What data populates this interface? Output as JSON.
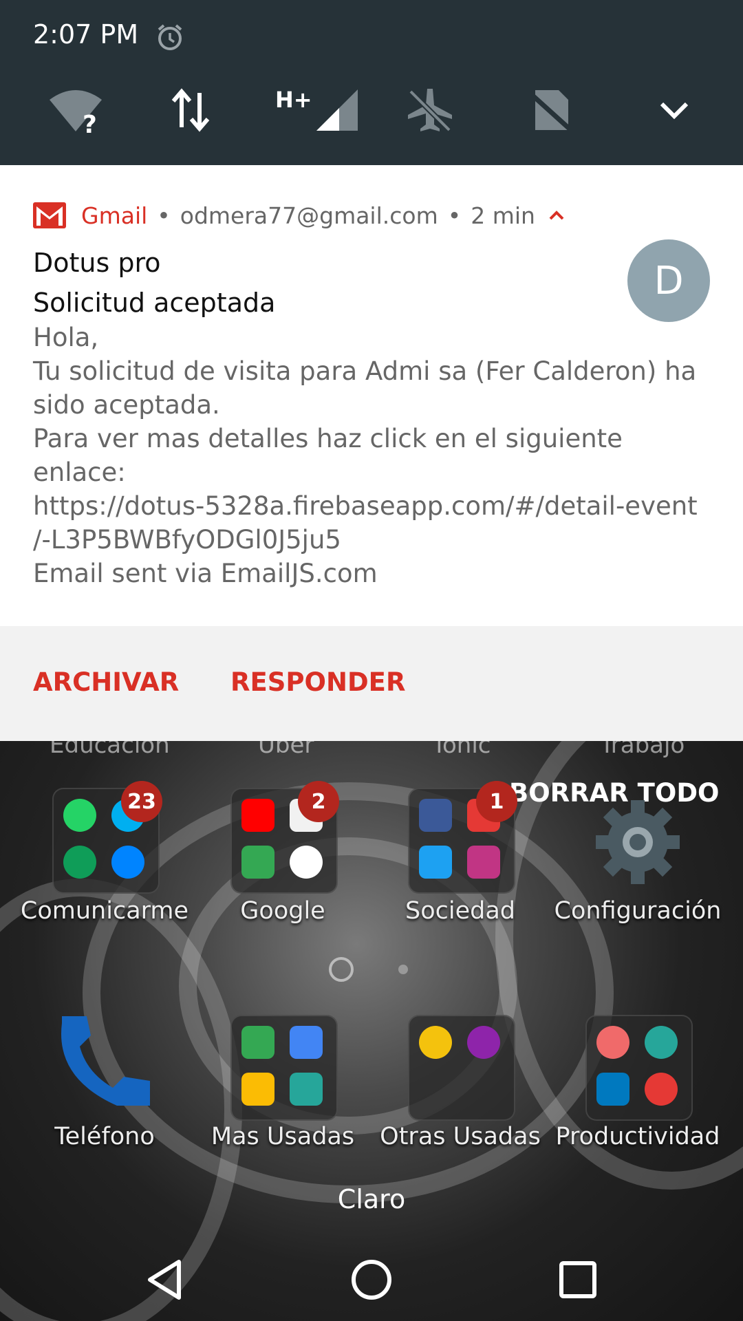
{
  "status": {
    "time": "2:07 PM",
    "network_label": "H+",
    "icons": [
      "alarm-icon",
      "wifi-question-icon",
      "data-arrows-icon",
      "signal-icon",
      "airplane-off-icon",
      "no-sim-icon",
      "chevron-down-icon"
    ]
  },
  "notification": {
    "app": "Gmail",
    "account": "odmera77@gmail.com",
    "time_ago": "2 min",
    "separator": "•",
    "sender": "Dotus pro",
    "subject": "Solicitud aceptada",
    "avatar_letter": "D",
    "body_lines": [
      "Hola,",
      "Tu solicitud de visita para Admi sa (Fer Calderon) ha",
      "sido aceptada.",
      "Para ver mas detalles haz click en el siguiente",
      "enlace:",
      "https://dotus-5328a.firebaseapp.com/#/detail-event",
      "/-L3P5BWBfyODGl0J5ju5",
      "Email sent via EmailJS.com"
    ],
    "actions": {
      "archive": "ARCHIVAR",
      "reply": "RESPONDER"
    },
    "colors": {
      "accent": "#d93025",
      "avatar": "#90a4ae"
    }
  },
  "home": {
    "clear_all": "BORRAR TODO",
    "partial_labels": [
      "Educación",
      "Uber",
      "Tonic",
      "Trabajo"
    ],
    "row1": [
      {
        "label": "Comunicarme",
        "badge": "23"
      },
      {
        "label": "Google",
        "badge": "2"
      },
      {
        "label": "Sociedad",
        "badge": "1"
      },
      {
        "label": "Configuración"
      }
    ],
    "row2": [
      {
        "label": "Teléfono"
      },
      {
        "label": "Mas Usadas"
      },
      {
        "label": "Otras Usadas"
      },
      {
        "label": "Productividad"
      }
    ],
    "carrier": "Claro"
  },
  "nav": {
    "icons": [
      "back-icon",
      "home-icon",
      "recents-icon"
    ]
  }
}
